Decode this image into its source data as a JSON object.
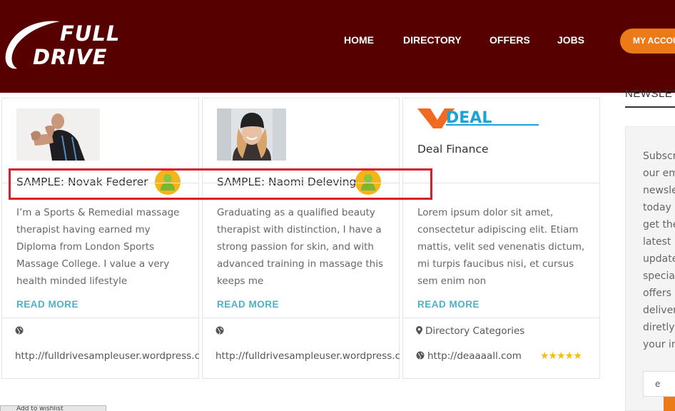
{
  "header": {
    "logo_line1": "FULL",
    "logo_line2": "DRIVE",
    "nav": [
      "HOME",
      "DIRECTORY",
      "OFFERS",
      "JOBS"
    ],
    "account_button": "MY ACCOUNT"
  },
  "colors": {
    "header_bg": "#570000",
    "accent_orange": "#ec7a17",
    "link_blue": "#4fb0c6",
    "highlight_red": "#d91e2a",
    "star_gold": "#f5c000"
  },
  "listings": [
    {
      "title": "SAMPLE: Novak Federer",
      "description": "I’m a Sports & Remedial massage therapist having earned my Diploma from London Sports Massage College. I value a very health minded lifestyle",
      "read_more": "READ MORE",
      "website": "http://fulldrivesampleuser.wordpress.com",
      "icon": "member-icon"
    },
    {
      "title": "SAMPLE: Naomi Delevingne",
      "description": "Graduating as a qualified beauty therapist with distinction, I have a strong passion for skin, and with advanced training in massage this keeps me",
      "read_more": "READ MORE",
      "website": "http://fulldrivesampleuser.wordpress.com",
      "icon": "member-icon"
    },
    {
      "logo_text": "DEAL",
      "title": "Deal Finance",
      "description": "Lorem ipsum dolor sit amet, consectetur adipiscing elit. Etiam mattis, velit sed venenatis dictum, mi turpis faucibus nisi, et cursus sem enim non",
      "read_more": "READ MORE",
      "category": "Directory Categories",
      "website": "http://deaaaall.com",
      "rating": 5,
      "stars": "★★★★★"
    }
  ],
  "sidebar": {
    "newsletter_title": "NEWSLETTER",
    "newsletter_lines": [
      "Subscr",
      "our em",
      "newsle",
      "today a",
      "get the",
      "latest n",
      "update",
      "special",
      "offers",
      "deliver",
      "diretly",
      "your in"
    ],
    "email_value": "e"
  },
  "bottom_tab": "Add to wishlist"
}
